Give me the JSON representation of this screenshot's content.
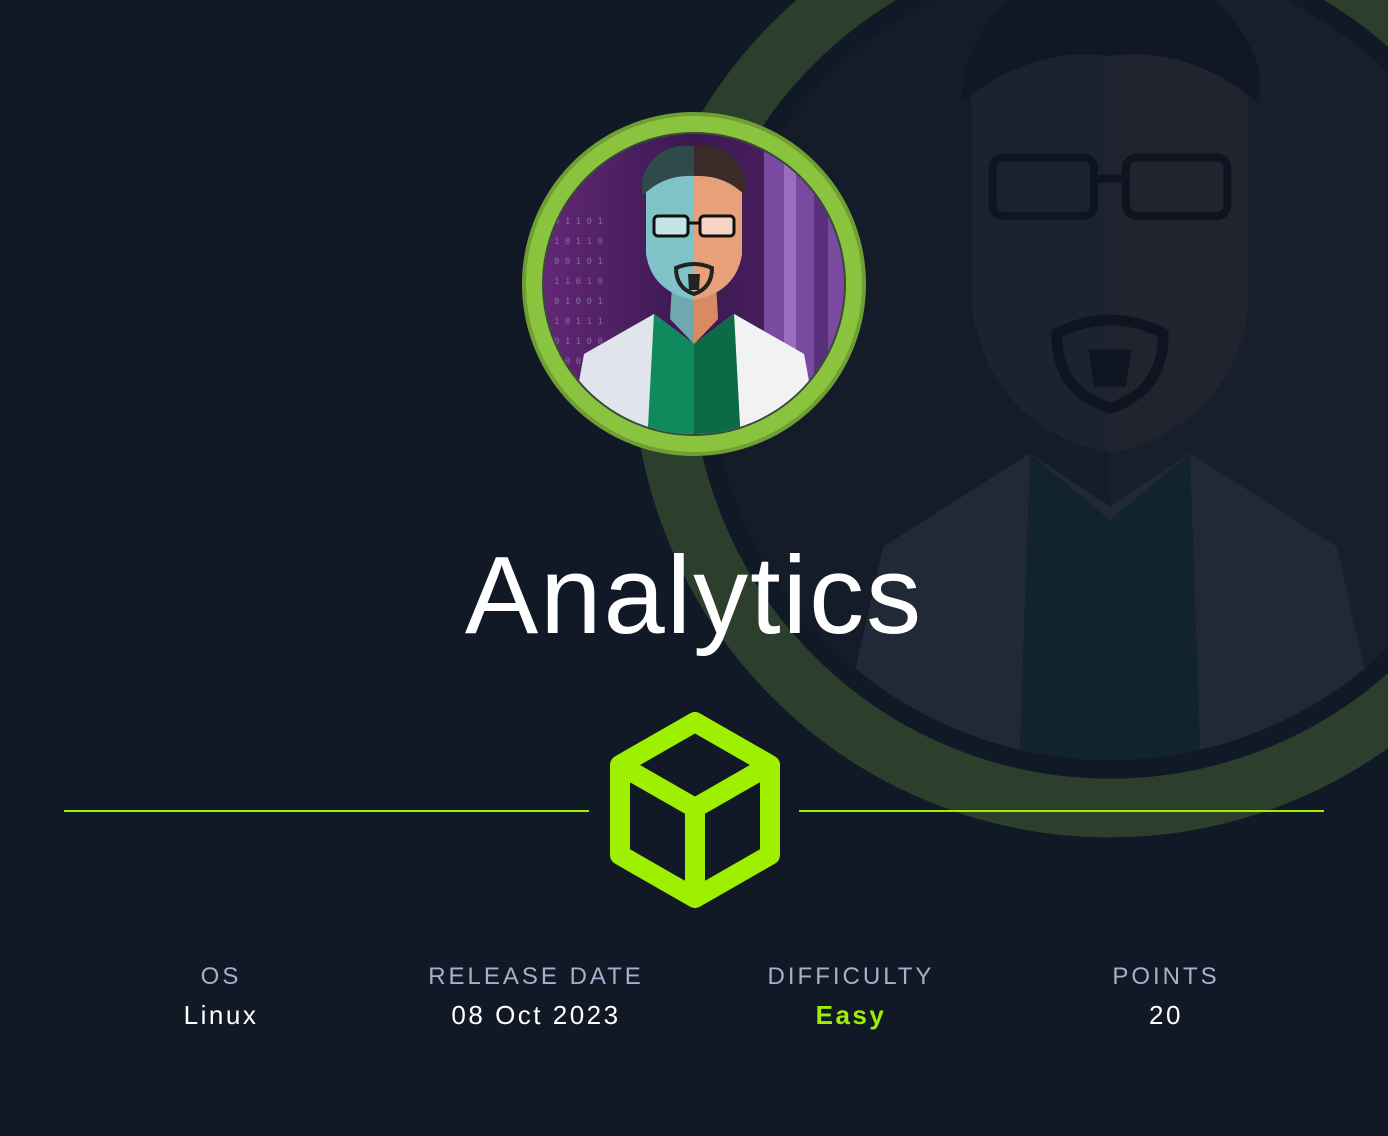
{
  "machine": {
    "name": "Analytics"
  },
  "stats": {
    "os": {
      "label": "OS",
      "value": "Linux"
    },
    "release_date": {
      "label": "RELEASE DATE",
      "value": "08 Oct 2023"
    },
    "difficulty": {
      "label": "DIFFICULTY",
      "value": "Easy"
    },
    "points": {
      "label": "POINTS",
      "value": "20"
    }
  },
  "icons": {
    "avatar": "machine-avatar-icon",
    "cube": "box-cube-icon"
  },
  "colors": {
    "background": "#111927",
    "accent": "#9fef00",
    "avatar_ring": "#8ac43f",
    "label": "#a4b1cd",
    "text": "#ffffff"
  }
}
